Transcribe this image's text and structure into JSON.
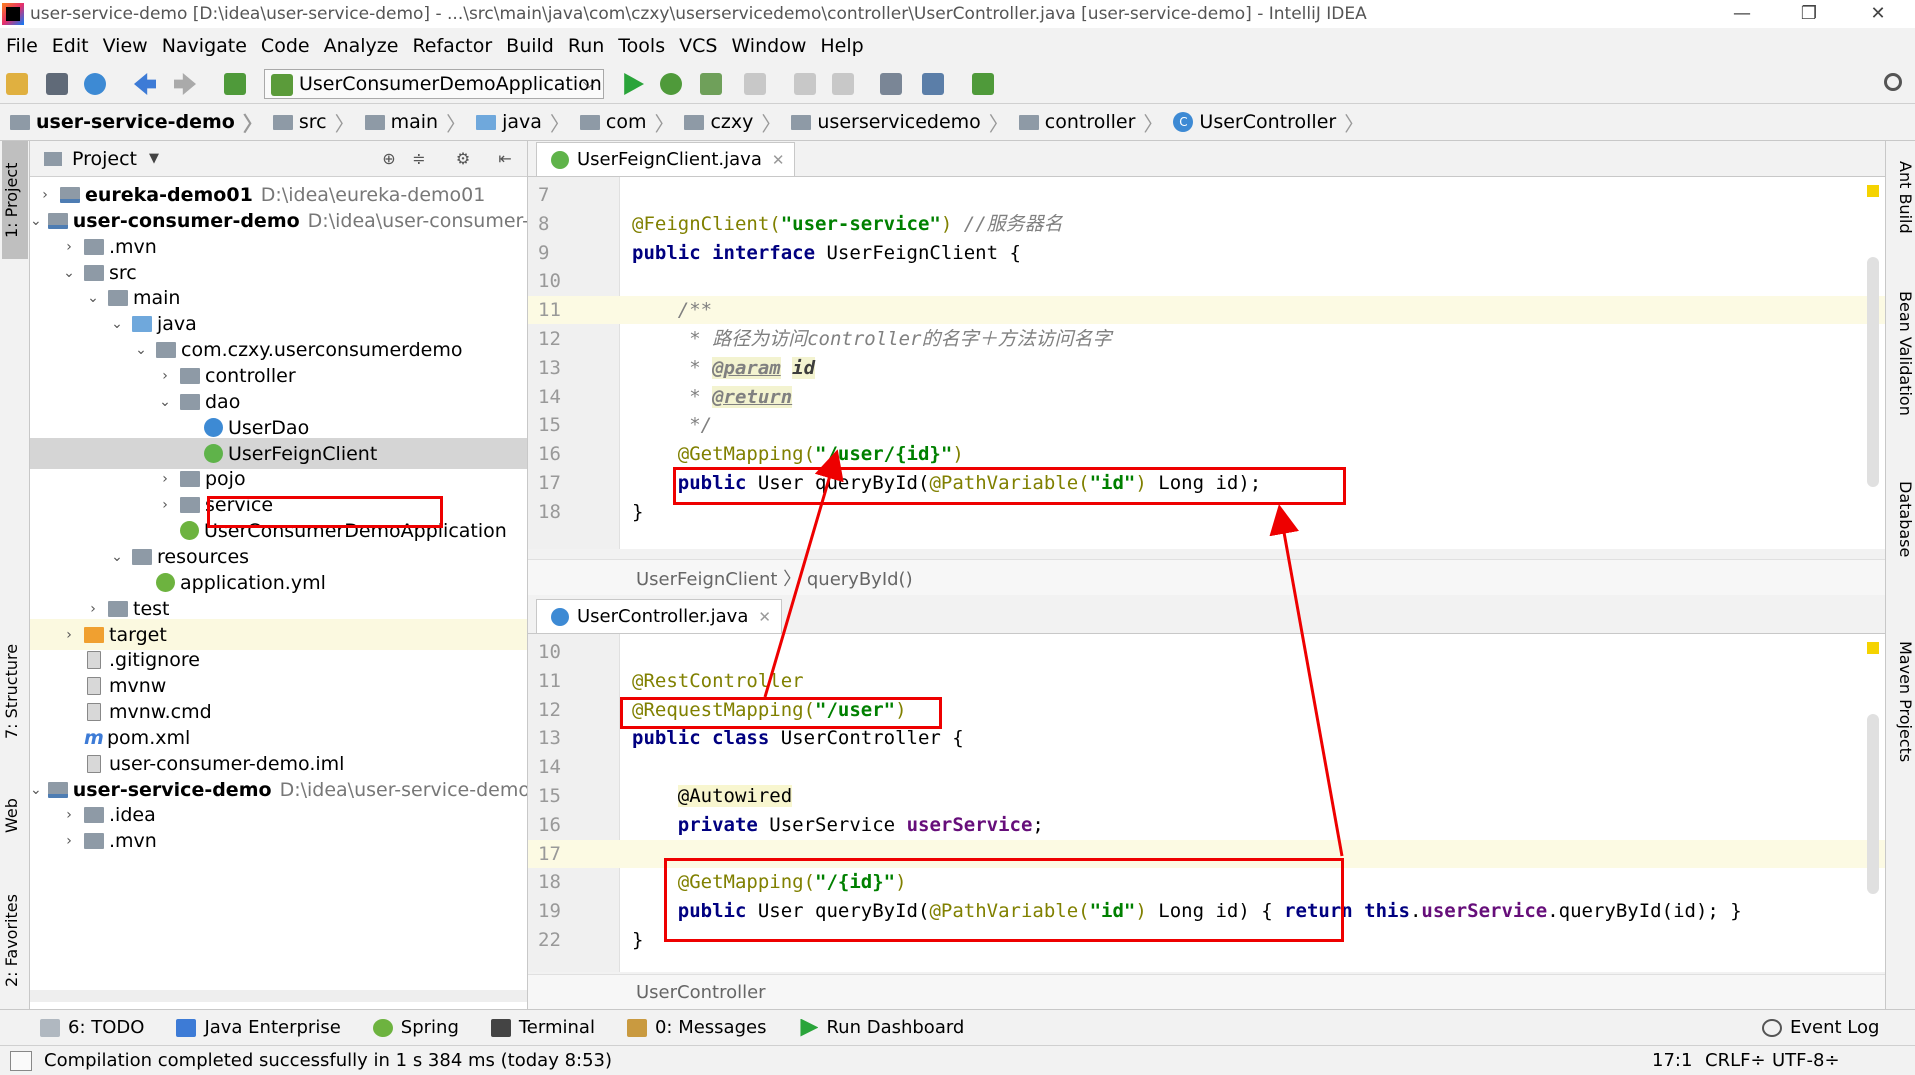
{
  "window": {
    "title": "user-service-demo [D:\\idea\\user-service-demo] - ...\\src\\main\\java\\com\\czxy\\userservicedemo\\controller\\UserController.java [user-service-demo] - IntelliJ IDEA",
    "minimize": "—",
    "restore": "❐",
    "close": "✕"
  },
  "menu": [
    "File",
    "Edit",
    "View",
    "Navigate",
    "Code",
    "Analyze",
    "Refactor",
    "Build",
    "Run",
    "Tools",
    "VCS",
    "Window",
    "Help"
  ],
  "toolbar": {
    "run_config": "UserConsumerDemoApplication"
  },
  "breadcrumb": [
    "user-service-demo",
    "src",
    "main",
    "java",
    "com",
    "czxy",
    "userservicedemo",
    "controller",
    "UserController"
  ],
  "left_strip": {
    "project": "1: Project",
    "structure": "7: Structure",
    "web": "Web",
    "favorites": "2: Favorites"
  },
  "right_strip": {
    "ant": "Ant Build",
    "bean": "Bean Validation",
    "database": "Database",
    "maven": "Maven Projects"
  },
  "project_panel": {
    "title": "Project",
    "tree": [
      {
        "label": "eureka-demo01",
        "path": "D:\\idea\\eureka-demo01",
        "bold": true
      },
      {
        "label": "user-consumer-demo",
        "path": "D:\\idea\\user-consumer-demo",
        "bold": true
      },
      {
        "label": ".mvn"
      },
      {
        "label": "src"
      },
      {
        "label": "main"
      },
      {
        "label": "java"
      },
      {
        "label": "com.czxy.userconsumerdemo"
      },
      {
        "label": "controller"
      },
      {
        "label": "dao"
      },
      {
        "label": "UserDao"
      },
      {
        "label": "UserFeignClient"
      },
      {
        "label": "pojo"
      },
      {
        "label": "service"
      },
      {
        "label": "UserConsumerDemoApplication"
      },
      {
        "label": "resources"
      },
      {
        "label": "application.yml"
      },
      {
        "label": "test"
      },
      {
        "label": "target"
      },
      {
        "label": ".gitignore"
      },
      {
        "label": "mvnw"
      },
      {
        "label": "mvnw.cmd"
      },
      {
        "label": "pom.xml"
      },
      {
        "label": "user-consumer-demo.iml"
      },
      {
        "label": "user-service-demo",
        "path": "D:\\idea\\user-service-demo",
        "bold": true
      },
      {
        "label": ".idea"
      },
      {
        "label": ".mvn"
      }
    ]
  },
  "editor_top": {
    "tab": "UserFeignClient.java",
    "tab_icon_letter": "I",
    "lines": [
      {
        "n": "7",
        "parts": []
      },
      {
        "n": "8",
        "parts": [
          [
            "ann",
            "@FeignClient("
          ],
          [
            "str",
            "\"user-service\""
          ],
          [
            "ann",
            ")"
          ],
          [
            "",
            " "
          ],
          [
            "cmt",
            "//服务器名"
          ]
        ]
      },
      {
        "n": "9",
        "parts": [
          [
            "kw",
            "public interface "
          ],
          [
            "",
            "UserFeignClient {"
          ]
        ]
      },
      {
        "n": "10",
        "parts": []
      },
      {
        "n": "11",
        "parts": [
          [
            "",
            "    "
          ],
          [
            "cmt",
            "/**"
          ]
        ]
      },
      {
        "n": "12",
        "parts": [
          [
            "cmt",
            "     * 路径为访问controller的名字＋方法访问名字"
          ]
        ]
      },
      {
        "n": "13",
        "parts": [
          [
            "cmt",
            "     * "
          ],
          [
            "tag",
            "@param"
          ],
          [
            "",
            " "
          ],
          [
            "param",
            "id"
          ]
        ]
      },
      {
        "n": "14",
        "parts": [
          [
            "cmt",
            "     * "
          ],
          [
            "tag",
            "@return"
          ]
        ]
      },
      {
        "n": "15",
        "parts": [
          [
            "cmt",
            "     */"
          ]
        ]
      },
      {
        "n": "16",
        "parts": [
          [
            "",
            "    "
          ],
          [
            "ann",
            "@GetMapping("
          ],
          [
            "str",
            "\"/user/{id}\""
          ],
          [
            "ann",
            ")"
          ]
        ]
      },
      {
        "n": "17",
        "parts": [
          [
            "",
            "    "
          ],
          [
            "kw",
            "public "
          ],
          [
            "",
            "User queryById("
          ],
          [
            "ann",
            "@PathVariable("
          ],
          [
            "str",
            "\"id\""
          ],
          [
            "ann",
            ")"
          ],
          [
            "",
            " Long id);"
          ]
        ]
      },
      {
        "n": "18",
        "parts": [
          [
            "",
            "}"
          ]
        ]
      }
    ],
    "crumbs": "UserFeignClient 〉 queryById()"
  },
  "editor_bottom": {
    "tab": "UserController.java",
    "tab_icon_letter": "C",
    "lines": [
      {
        "n": "10",
        "parts": []
      },
      {
        "n": "11",
        "parts": [
          [
            "ann",
            "@RestController"
          ]
        ]
      },
      {
        "n": "12",
        "parts": [
          [
            "ann",
            "@RequestMapping("
          ],
          [
            "str",
            "\"/user\""
          ],
          [
            "ann",
            ")"
          ]
        ]
      },
      {
        "n": "13",
        "parts": [
          [
            "kw",
            "public class "
          ],
          [
            "",
            "UserController {"
          ]
        ]
      },
      {
        "n": "14",
        "parts": []
      },
      {
        "n": "15",
        "parts": [
          [
            "",
            "    "
          ],
          [
            "anbg",
            "@Autowired"
          ]
        ]
      },
      {
        "n": "16",
        "parts": [
          [
            "",
            "    "
          ],
          [
            "kw",
            "private "
          ],
          [
            "",
            "UserService "
          ],
          [
            "field",
            "userService"
          ],
          [
            "",
            ";"
          ]
        ]
      },
      {
        "n": "17",
        "parts": []
      },
      {
        "n": "18",
        "parts": [
          [
            "",
            "    "
          ],
          [
            "ann",
            "@GetMapping("
          ],
          [
            "str",
            "\"/{id}\""
          ],
          [
            "ann",
            ")"
          ]
        ]
      },
      {
        "n": "19",
        "parts": [
          [
            "",
            "    "
          ],
          [
            "kw",
            "public "
          ],
          [
            "",
            "User queryById("
          ],
          [
            "ann",
            "@PathVariable("
          ],
          [
            "str",
            "\"id\""
          ],
          [
            "ann",
            ")"
          ],
          [
            "",
            " Long id) { "
          ],
          [
            "kw",
            "return this"
          ],
          [
            "",
            "."
          ],
          [
            "field",
            "userService"
          ],
          [
            "",
            ".queryById(id); }"
          ]
        ]
      },
      {
        "n": "22",
        "parts": [
          [
            "",
            "}"
          ]
        ]
      }
    ],
    "crumbs": "UserController"
  },
  "bottom_tabs": [
    "6: TODO",
    "Java Enterprise",
    "Spring",
    "Terminal",
    "0: Messages",
    "Run Dashboard"
  ],
  "event_log": "Event Log",
  "status": {
    "message": "Compilation completed successfully in 1 s 384 ms (today 8:53)",
    "position": "17:1",
    "line_sep": "CRLF÷",
    "encoding": "UTF-8÷"
  },
  "colors": {
    "annotation_box": "#e00000",
    "keyword": "#000080",
    "string": "#008000",
    "annotation": "#808000"
  }
}
